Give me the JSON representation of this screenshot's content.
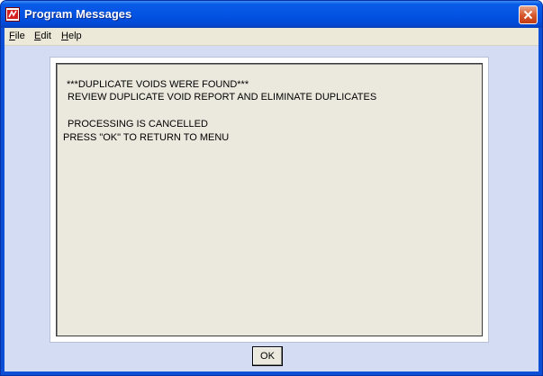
{
  "window": {
    "title": "Program Messages"
  },
  "menu": [
    {
      "underline": "F",
      "rest": "ile"
    },
    {
      "underline": "E",
      "rest": "dit"
    },
    {
      "underline": "H",
      "rest": "elp"
    }
  ],
  "message_lines": [
    "***DUPLICATE VOIDS WERE FOUND***",
    " REVIEW DUPLICATE VOID REPORT AND ELIMINATE DUPLICATES",
    " PROCESSING IS CANCELLED",
    "PRESS \"OK\" TO RETURN TO MENU"
  ],
  "buttons": {
    "ok": "OK"
  },
  "icons": {
    "app": "app-icon",
    "close": "close-icon"
  },
  "colors": {
    "titlebar": "#0454e3",
    "client": "#d4dcf4",
    "message_bg": "#ebe8de"
  }
}
